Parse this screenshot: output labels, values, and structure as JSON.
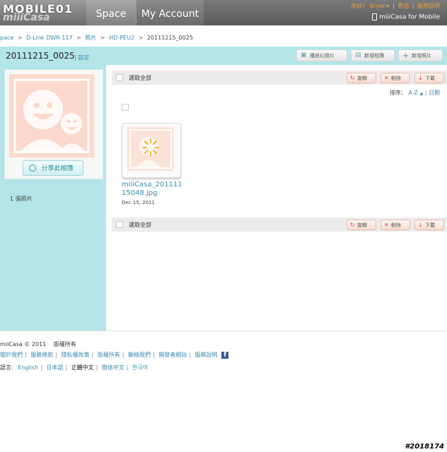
{
  "header": {
    "logo_text": "MOBILE01",
    "logo_sub": "miiiCasa",
    "tabs": [
      {
        "label": "Space"
      },
      {
        "label": "My Account"
      }
    ],
    "greeting": "你好！",
    "username": "Bryan",
    "user_caret": "▾",
    "logout": "登出",
    "help": "服務說明",
    "mobile_link": "miiiCasa for Mobile"
  },
  "breadcrumb": [
    "pace",
    "D-Link DWR-117",
    "照片",
    "HD-PEU2",
    "20111215_0025"
  ],
  "breadcrumb_sep": ">",
  "album": {
    "title": "20111215_0025",
    "settings_label": "設定",
    "toolbar": {
      "slideshow": "播放幻燈片",
      "new_album": "新增相簿",
      "add_photo": "新增照片"
    },
    "share_label": "分享此相簿",
    "photo_count": "1 張照片"
  },
  "actions": {
    "select_all": "選取全部",
    "rotate": "旋轉",
    "delete": "刪除",
    "download": "下載"
  },
  "sort": {
    "label": "排序：",
    "az": "A-Z",
    "date": "日期"
  },
  "photos": [
    {
      "name": "miiiCasa_20111115048.jpg",
      "date": "Dec 15, 2011"
    }
  ],
  "footer": {
    "copyright": "miiCasa © 2011",
    "rights": "版權所有",
    "links": [
      "關於我們",
      "服務條款",
      "隱私權政策",
      "版權所有",
      "聯絡我們",
      "開發者網站",
      "服務說明"
    ],
    "lang_label": "語言:",
    "languages": [
      "English",
      "日本語",
      "正體中文",
      "簡体中文",
      "한국어"
    ]
  },
  "watermark": "#2018174",
  "colors": {
    "accent_teal": "#b4e5e8",
    "link_blue": "#3a8ab0",
    "action_red": "#d44444"
  }
}
